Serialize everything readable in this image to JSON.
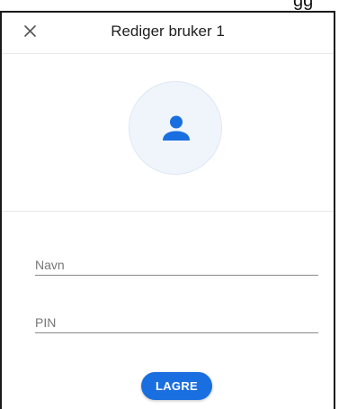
{
  "corner_text": "gg",
  "dialog": {
    "title": "Rediger bruker 1",
    "close_icon": "close-icon"
  },
  "avatar": {
    "icon": "person-icon",
    "icon_color": "#1a6fe0",
    "background": "#f0f5fc"
  },
  "form": {
    "name_placeholder": "Navn",
    "pin_placeholder": "PIN",
    "save_label": "LAGRE",
    "accent_color": "#1a6fe0"
  }
}
